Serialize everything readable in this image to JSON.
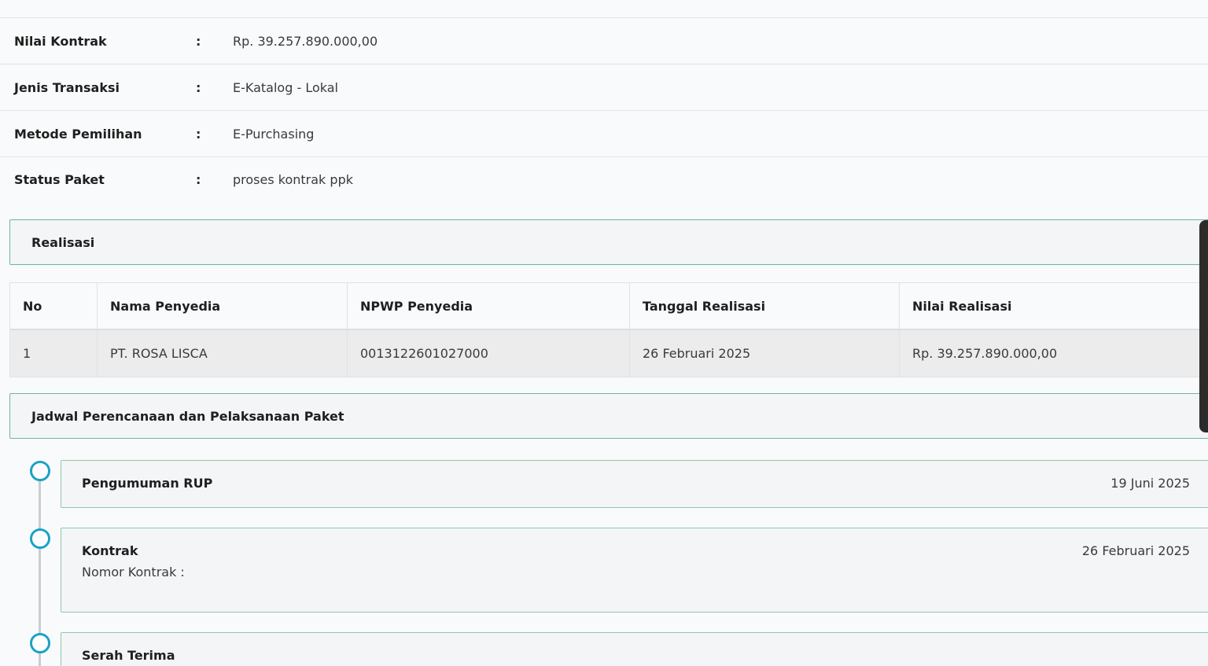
{
  "details": {
    "cut_off_text": "",
    "rows": [
      {
        "label": "Nilai Kontrak",
        "colon": ":",
        "value": "Rp. 39.257.890.000,00"
      },
      {
        "label": "Jenis Transaksi",
        "colon": ":",
        "value": "E-Katalog - Lokal"
      },
      {
        "label": "Metode Pemilihan",
        "colon": ":",
        "value": "E-Purchasing"
      },
      {
        "label": "Status Paket",
        "colon": ":",
        "value": "proses kontrak ppk"
      }
    ]
  },
  "realisasi": {
    "title": "Realisasi",
    "columns": [
      "No",
      "Nama Penyedia",
      "NPWP Penyedia",
      "Tanggal Realisasi",
      "Nilai Realisasi"
    ],
    "rows": [
      [
        "1",
        "PT. ROSA LISCA",
        "0013122601027000",
        "26 Februari 2025",
        "Rp. 39.257.890.000,00"
      ]
    ]
  },
  "jadwal": {
    "title": "Jadwal Perencanaan dan Pelaksanaan Paket",
    "items": [
      {
        "title": "Pengumuman RUP",
        "date": "19 Juni 2025",
        "sub": ""
      },
      {
        "title": "Kontrak",
        "date": "26 Februari 2025",
        "sub": "Nomor Kontrak :"
      },
      {
        "title": "Serah Terima",
        "date": "",
        "sub": ""
      }
    ]
  },
  "colors": {
    "accent_border": "#6fb3a9",
    "timeline_circle": "#1aa3c4",
    "card_border": "#8fc9a6"
  }
}
